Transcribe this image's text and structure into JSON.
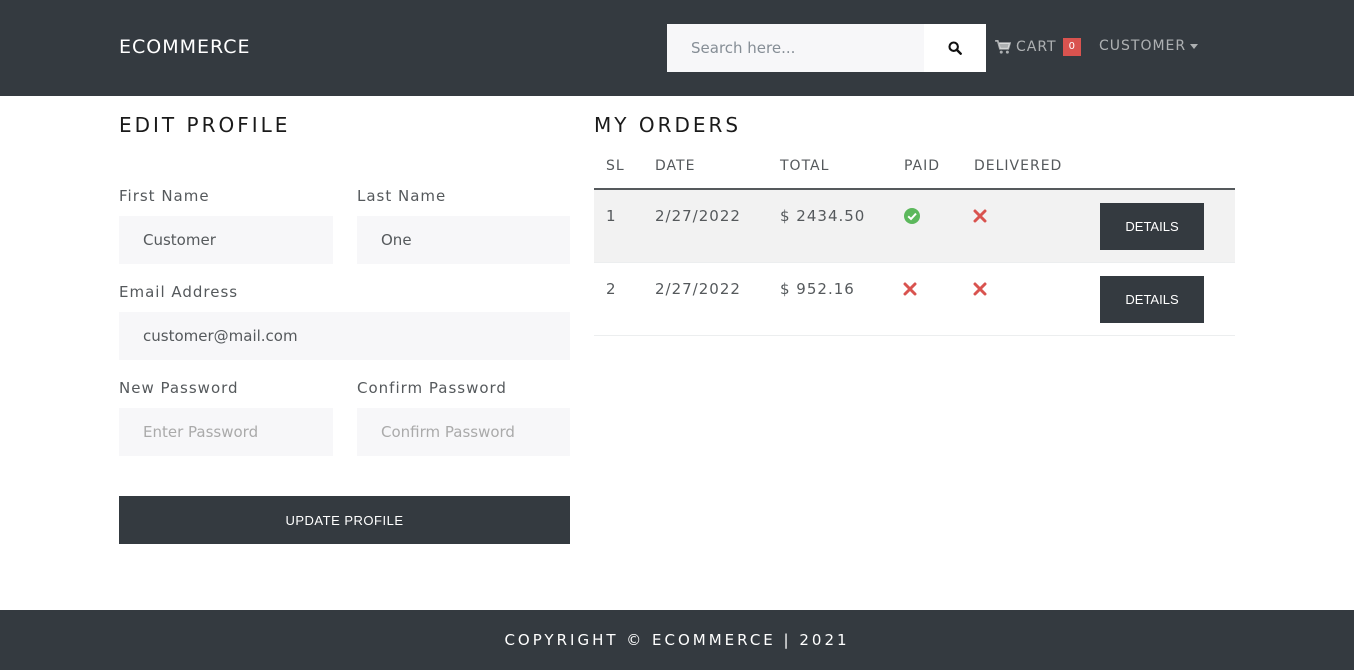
{
  "navbar": {
    "brand": "ECOMMERCE",
    "search_placeholder": "Search here...",
    "cart_label": "CART",
    "cart_count": "0",
    "customer_label": "CUSTOMER"
  },
  "edit_profile": {
    "title": "EDIT PROFILE",
    "first_name_label": "First Name",
    "first_name_value": "Customer",
    "last_name_label": "Last Name",
    "last_name_value": "One",
    "email_label": "Email Address",
    "email_value": "customer@mail.com",
    "new_password_label": "New Password",
    "new_password_placeholder": "Enter Password",
    "confirm_password_label": "Confirm Password",
    "confirm_password_placeholder": "Confirm Password",
    "update_button": "UPDATE PROFILE"
  },
  "orders": {
    "title": "MY ORDERS",
    "columns": [
      "SL",
      "DATE",
      "TOTAL",
      "PAID",
      "DELIVERED"
    ],
    "rows": [
      {
        "sl": "1",
        "date": "2/27/2022",
        "total": "$ 2434.50",
        "paid": "check-circle-icon",
        "delivered": "times-icon",
        "button": "DETAILS"
      },
      {
        "sl": "2",
        "date": "2/27/2022",
        "total": "$ 952.16",
        "paid": "times-icon",
        "delivered": "times-icon",
        "button": "DETAILS"
      }
    ]
  },
  "footer": {
    "text": "COPYRIGHT © ECOMMERCE | 2021"
  },
  "colors": {
    "navbar_bg": "#343a40",
    "success": "#5cb85c",
    "danger": "#d9534f"
  }
}
